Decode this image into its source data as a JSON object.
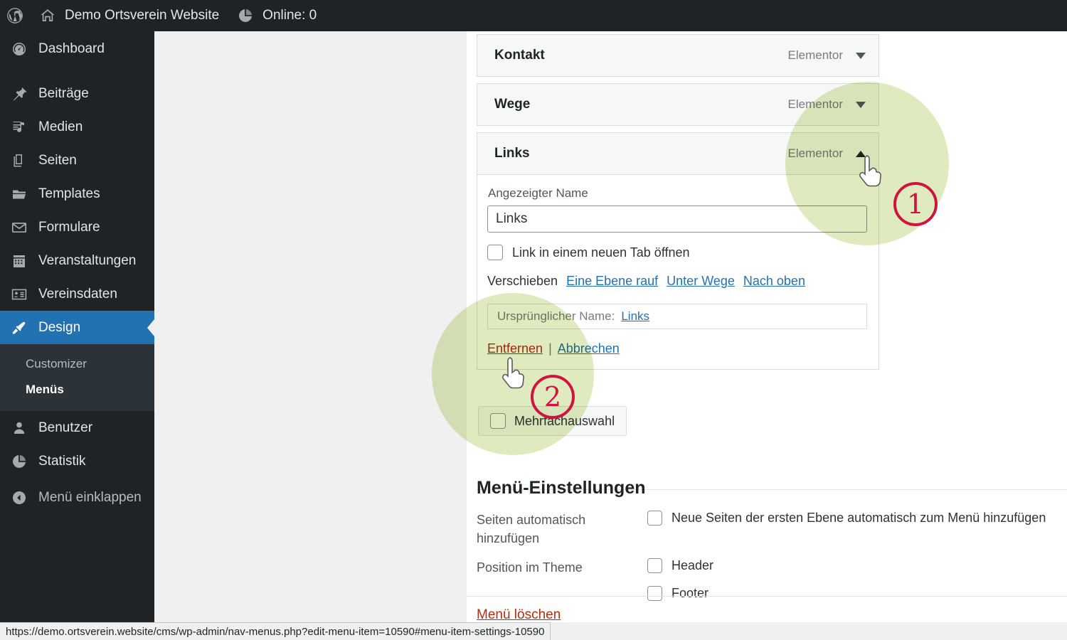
{
  "adminbar": {
    "logo_icon": "wordpress-logo-icon",
    "site_icon": "home-icon",
    "site_name": "Demo Ortsverein Website",
    "online_icon": "pie-chart-icon",
    "online_label": "Online: 0"
  },
  "sidebar": {
    "items": [
      {
        "label": "Dashboard",
        "icon": "dashboard-icon"
      },
      {
        "label": "Beiträge",
        "icon": "pin-icon"
      },
      {
        "label": "Medien",
        "icon": "media-icon"
      },
      {
        "label": "Seiten",
        "icon": "pages-icon"
      },
      {
        "label": "Templates",
        "icon": "folder-icon"
      },
      {
        "label": "Formulare",
        "icon": "envelope-icon"
      },
      {
        "label": "Veranstaltungen",
        "icon": "calendar-icon"
      },
      {
        "label": "Vereinsdaten",
        "icon": "id-card-icon"
      },
      {
        "label": "Design",
        "icon": "paintbrush-icon"
      },
      {
        "label": "Benutzer",
        "icon": "user-icon"
      },
      {
        "label": "Statistik",
        "icon": "pie-chart-icon"
      },
      {
        "label": "Menü einklappen",
        "icon": "collapse-arrow-icon"
      }
    ],
    "submenu": [
      {
        "label": "Customizer"
      },
      {
        "label": "Menüs"
      }
    ]
  },
  "menu_items": [
    {
      "title": "Kontakt",
      "type": "Elementor",
      "expanded": false,
      "caret": "chevron-down-icon"
    },
    {
      "title": "Wege",
      "type": "Elementor",
      "expanded": false,
      "caret": "chevron-down-icon"
    },
    {
      "title": "Links",
      "type": "Elementor",
      "expanded": true,
      "caret": "chevron-up-icon"
    }
  ],
  "edit_panel": {
    "name_label": "Angezeigter Name",
    "name_value": "Links",
    "new_tab_label": "Link in einem neuen Tab öffnen",
    "move_label": "Verschieben",
    "move_links": [
      "Eine Ebene rauf",
      "Unter Wege",
      "Nach oben"
    ],
    "original_label": "Ursprünglicher Name:",
    "original_value": "Links",
    "remove_label": "Entfernen",
    "separator": "|",
    "cancel_label": "Abbrechen"
  },
  "multiselect": {
    "label": "Mehrfachauswahl"
  },
  "settings": {
    "title": "Menü-Einstellungen",
    "rows": [
      {
        "label": "Seiten automatisch hinzufügen",
        "options": [
          "Neue Seiten der ersten Ebene automatisch zum Menü hinzufügen"
        ]
      },
      {
        "label": "Position im Theme",
        "options": [
          "Header",
          "Footer"
        ]
      }
    ]
  },
  "delete_menu": {
    "label": "Menü löschen"
  },
  "statusbar": {
    "url": "https://demo.ortsverein.website/cms/wp-admin/nav-menus.php?edit-menu-item=10590#menu-item-settings-10590"
  },
  "annotations": {
    "badges": [
      {
        "number": "1"
      },
      {
        "number": "2"
      }
    ]
  },
  "colors": {
    "admin_dark": "#1d2327",
    "accent_blue": "#2271b1",
    "link_blue": "#2271b1",
    "danger_red": "#b32d0e",
    "highlight_green": "#dbe9b6",
    "badge_crimson": "#d0133f"
  }
}
